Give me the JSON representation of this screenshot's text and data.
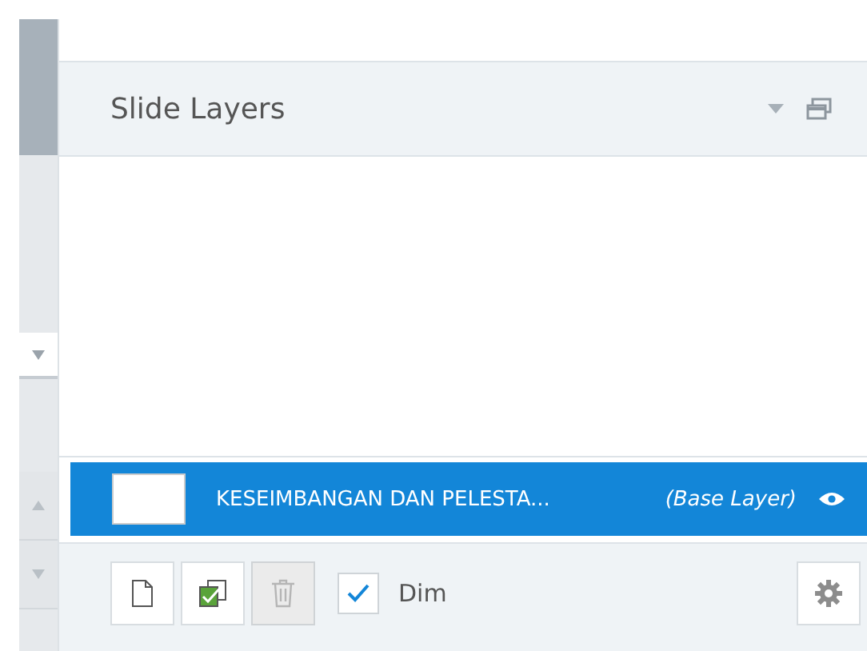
{
  "panel": {
    "title": "Slide Layers"
  },
  "layers": [
    {
      "name": "KESEIMBANGAN DAN PELESTA...",
      "tag": "(Base Layer)",
      "selected": true
    }
  ],
  "toolbar": {
    "buttons": [
      {
        "kind": "new",
        "disabled": false
      },
      {
        "kind": "duplicate",
        "disabled": false
      },
      {
        "kind": "delete",
        "disabled": true
      }
    ],
    "dim": {
      "label": "Dim",
      "checked": true
    }
  }
}
